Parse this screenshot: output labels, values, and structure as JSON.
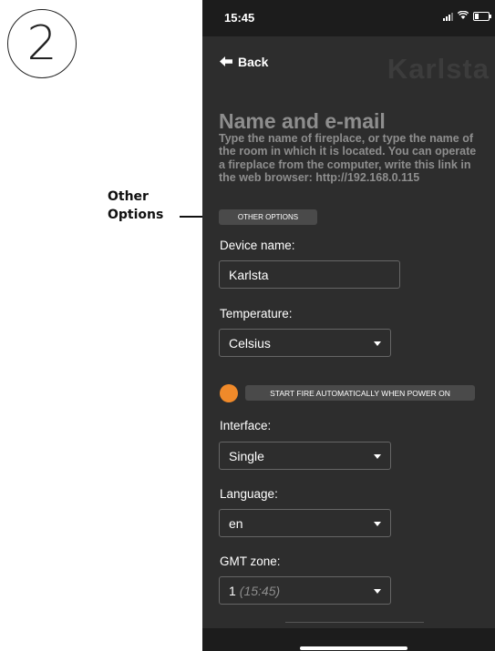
{
  "annotation": {
    "step_number": "2",
    "callout_line1": "Other",
    "callout_line2": "Options"
  },
  "status_bar": {
    "time": "15:45"
  },
  "header": {
    "back_label": "Back",
    "device_title": "Karlsta"
  },
  "section": {
    "title": "Name and e-mail",
    "description": "Type the name of fireplace, or type the name of the room in which it is located. You can operate a fireplace from the computer, write this link in the web browser: http://192.168.0.115"
  },
  "buttons": {
    "other_options": "OTHER OPTIONS",
    "start_fire": "START FIRE AUTOMATICALLY WHEN POWER ON"
  },
  "form": {
    "device_name_label": "Device name:",
    "device_name_value": "Karlsta",
    "temperature_label": "Temperature:",
    "temperature_value": "Celsius",
    "interface_label": "Interface:",
    "interface_value": "Single",
    "language_label": "Language:",
    "language_value": "en",
    "gmt_label": "GMT zone:",
    "gmt_value": "1",
    "gmt_time": "(15:45)"
  },
  "colors": {
    "accent": "#f08a2a",
    "background": "#2d2d2d",
    "statusbar": "#1c1c1c"
  }
}
